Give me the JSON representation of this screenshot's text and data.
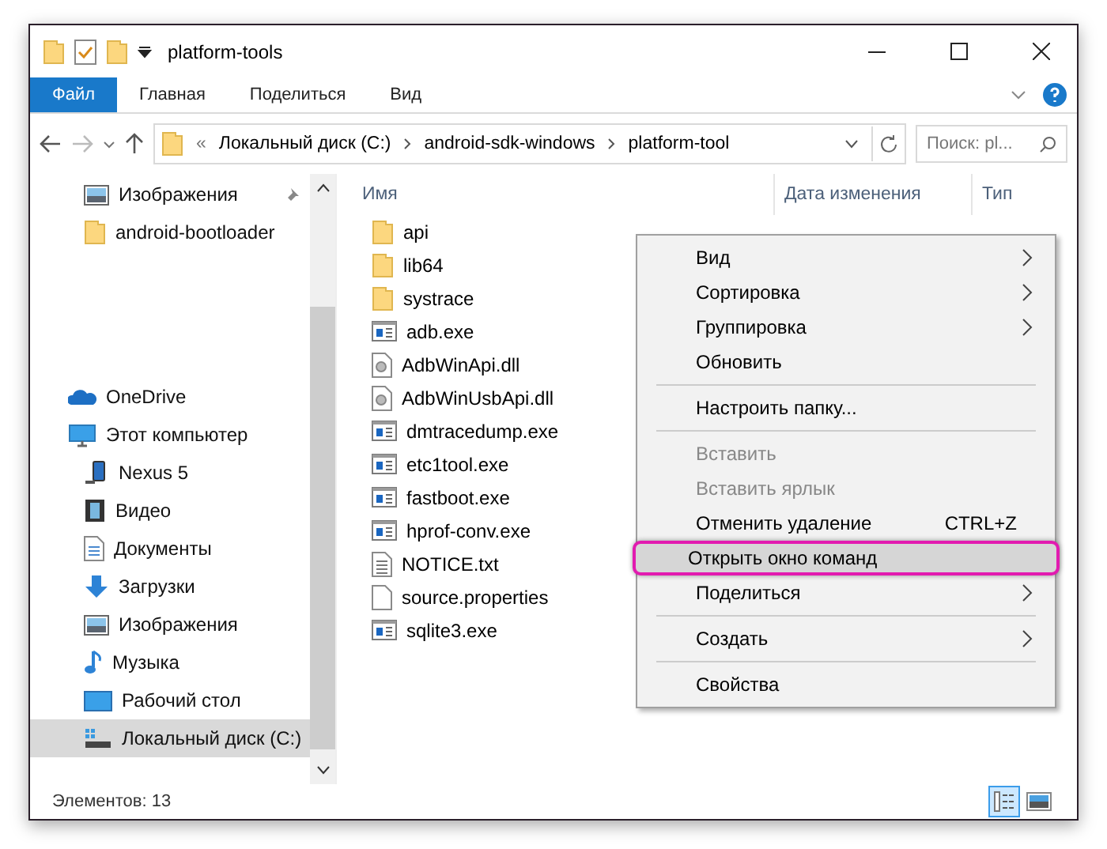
{
  "window": {
    "title": "platform-tools"
  },
  "ribbon_tabs": [
    {
      "label": "Файл",
      "selected": true
    },
    {
      "label": "Главная",
      "selected": false
    },
    {
      "label": "Поделиться",
      "selected": false
    },
    {
      "label": "Вид",
      "selected": false
    }
  ],
  "address": {
    "overflow": "«",
    "crumbs": [
      "Локальный диск (C:)",
      "android-sdk-windows",
      "platform-tool"
    ]
  },
  "search": {
    "placeholder": "Поиск: pl..."
  },
  "nav": [
    {
      "label": "Изображения",
      "kind": "pictures",
      "pinned": true,
      "selected": false
    },
    {
      "label": "android-bootloader",
      "kind": "folder",
      "pinned": false,
      "selected": false
    },
    {
      "label": "OneDrive",
      "kind": "cloud",
      "pinned": false,
      "selected": false,
      "gap": true
    },
    {
      "label": "Этот компьютер",
      "kind": "computer",
      "pinned": false,
      "selected": false,
      "children": [
        {
          "label": "Nexus 5",
          "kind": "phone",
          "selected": false
        },
        {
          "label": "Видео",
          "kind": "video",
          "selected": false
        },
        {
          "label": "Документы",
          "kind": "docs",
          "selected": false
        },
        {
          "label": "Загрузки",
          "kind": "downloads",
          "selected": false
        },
        {
          "label": "Изображения",
          "kind": "pictures",
          "selected": false
        },
        {
          "label": "Музыка",
          "kind": "music",
          "selected": false
        },
        {
          "label": "Рабочий стол",
          "kind": "desktop",
          "selected": false
        },
        {
          "label": "Локальный диск (C:)",
          "kind": "drive",
          "selected": true
        }
      ]
    }
  ],
  "columns": [
    "Имя",
    "Дата изменения",
    "Тип"
  ],
  "files": [
    {
      "name": "api",
      "kind": "folder"
    },
    {
      "name": "lib64",
      "kind": "folder"
    },
    {
      "name": "systrace",
      "kind": "folder"
    },
    {
      "name": "adb.exe",
      "kind": "exe"
    },
    {
      "name": "AdbWinApi.dll",
      "kind": "dll"
    },
    {
      "name": "AdbWinUsbApi.dll",
      "kind": "dll"
    },
    {
      "name": "dmtracedump.exe",
      "kind": "exe"
    },
    {
      "name": "etc1tool.exe",
      "kind": "exe"
    },
    {
      "name": "fastboot.exe",
      "kind": "exe"
    },
    {
      "name": "hprof-conv.exe",
      "kind": "exe"
    },
    {
      "name": "NOTICE.txt",
      "kind": "txt"
    },
    {
      "name": "source.properties",
      "kind": "file"
    },
    {
      "name": "sqlite3.exe",
      "kind": "exe"
    }
  ],
  "context_menu": [
    {
      "kind": "item",
      "label": "Вид",
      "submenu": true,
      "disabled": false,
      "selected": false
    },
    {
      "kind": "item",
      "label": "Сортировка",
      "submenu": true,
      "disabled": false,
      "selected": false
    },
    {
      "kind": "item",
      "label": "Группировка",
      "submenu": true,
      "disabled": false,
      "selected": false
    },
    {
      "kind": "item",
      "label": "Обновить",
      "submenu": false,
      "disabled": false,
      "selected": false
    },
    {
      "kind": "separator"
    },
    {
      "kind": "item",
      "label": "Настроить папку...",
      "submenu": false,
      "disabled": false,
      "selected": false
    },
    {
      "kind": "separator"
    },
    {
      "kind": "item",
      "label": "Вставить",
      "submenu": false,
      "disabled": true,
      "selected": false
    },
    {
      "kind": "item",
      "label": "Вставить ярлык",
      "submenu": false,
      "disabled": true,
      "selected": false
    },
    {
      "kind": "item",
      "label": "Отменить удаление",
      "shortcut": "CTRL+Z",
      "submenu": false,
      "disabled": false,
      "selected": false
    },
    {
      "kind": "item",
      "label": "Открыть окно команд",
      "submenu": false,
      "disabled": false,
      "selected": true
    },
    {
      "kind": "item",
      "label": "Поделиться",
      "submenu": true,
      "disabled": false,
      "selected": false
    },
    {
      "kind": "separator"
    },
    {
      "kind": "item",
      "label": "Создать",
      "submenu": true,
      "disabled": false,
      "selected": false
    },
    {
      "kind": "separator"
    },
    {
      "kind": "item",
      "label": "Свойства",
      "submenu": false,
      "disabled": false,
      "selected": false
    }
  ],
  "status_bar": {
    "count": "Элементов: 13"
  },
  "view_buttons": [
    {
      "kind": "details",
      "selected": true
    },
    {
      "kind": "tiles",
      "selected": false
    }
  ]
}
